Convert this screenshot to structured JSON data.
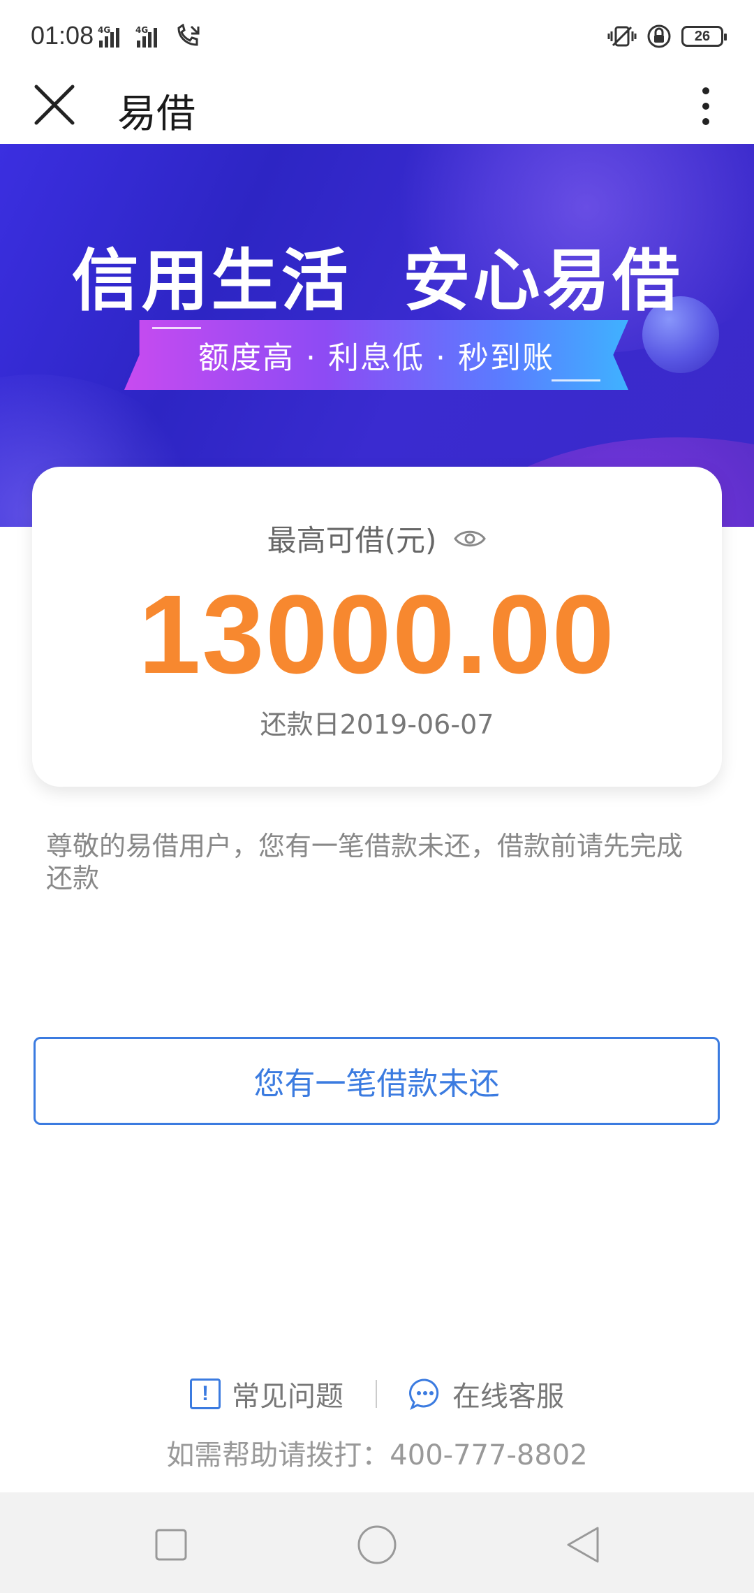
{
  "status_bar": {
    "time": "01:08",
    "network_1": "4G",
    "network_2": "4G",
    "battery": "26"
  },
  "header": {
    "title": "易借",
    "close_icon": "close-icon",
    "more_icon": "more-vertical-icon"
  },
  "banner": {
    "headline": "信用生活  安心易借",
    "ribbon": "额度高 · 利息低 · 秒到账"
  },
  "card": {
    "label": "最高可借(元)",
    "amount": "13000.00",
    "due_date": "还款日2019-06-07"
  },
  "notice": "尊敬的易借用户，您有一笔借款未还，借款前请先完成还款",
  "primary_button": "您有一笔借款未还",
  "footer": {
    "faq": "常见问题",
    "online_service": "在线客服",
    "hotline": "如需帮助请拨打：400-777-8802"
  },
  "colors": {
    "accent_orange": "#f7882f",
    "accent_blue": "#3b7be0",
    "banner_blue": "#2d25c4"
  }
}
